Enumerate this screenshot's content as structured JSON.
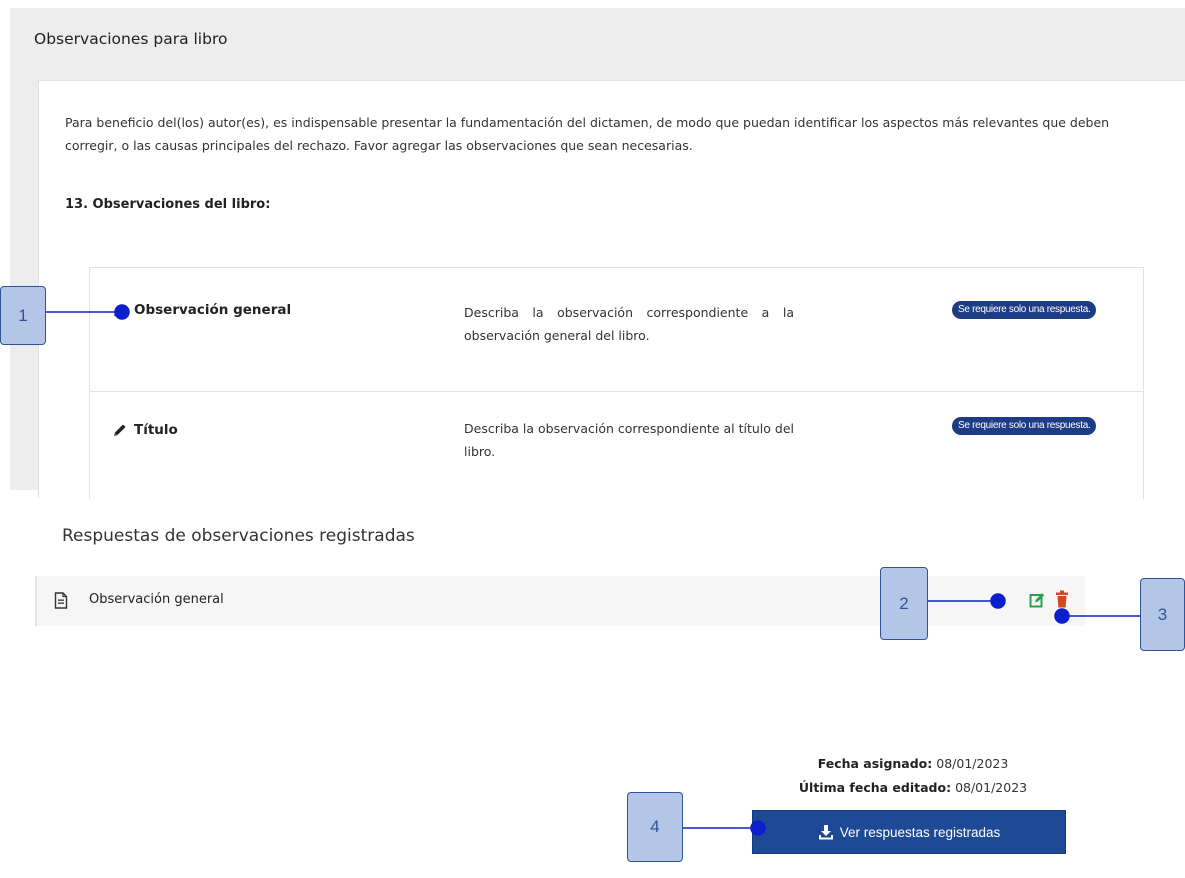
{
  "panel": {
    "title": "Observaciones para libro",
    "intro": "Para beneficio del(los) autor(es), es indispensable presentar la fundamentación del dictamen, de modo que puedan identificar los aspectos más relevantes que deben corregir, o las causas principales del rechazo. Favor agregar las observaciones que sean necesarias.",
    "section_label": "13. Observaciones del libro:",
    "items": [
      {
        "name": "Observación general",
        "description": "Describa la observación correspondiente a la observación general del libro.",
        "badge": "Se requiere solo una respuesta."
      },
      {
        "name": "Título",
        "description": "Describa la observación correspondiente al título del libro.",
        "badge": "Se requiere solo una respuesta."
      }
    ]
  },
  "responses": {
    "title": "Respuestas de observaciones registradas",
    "rows": [
      {
        "label": "Observación general"
      }
    ]
  },
  "meta": {
    "assigned_label": "Fecha asignado:",
    "assigned_value": "08/01/2023",
    "edited_label": "Última fecha editado:",
    "edited_value": "08/01/2023"
  },
  "view_button": {
    "label": "Ver respuestas registradas"
  },
  "callouts": [
    "1",
    "2",
    "3",
    "4"
  ],
  "colors": {
    "primary": "#1e4a95",
    "badge": "#1e3c84",
    "edit": "#2e9e4f",
    "delete": "#d04a1c",
    "callout_fill": "#b4c6e7",
    "callout_border": "#2f5597",
    "leader": "#0b1fcc"
  },
  "icons": {
    "item": "pencil-icon",
    "response": "document-icon",
    "edit": "edit-icon",
    "delete": "trash-icon",
    "download": "download-icon"
  }
}
